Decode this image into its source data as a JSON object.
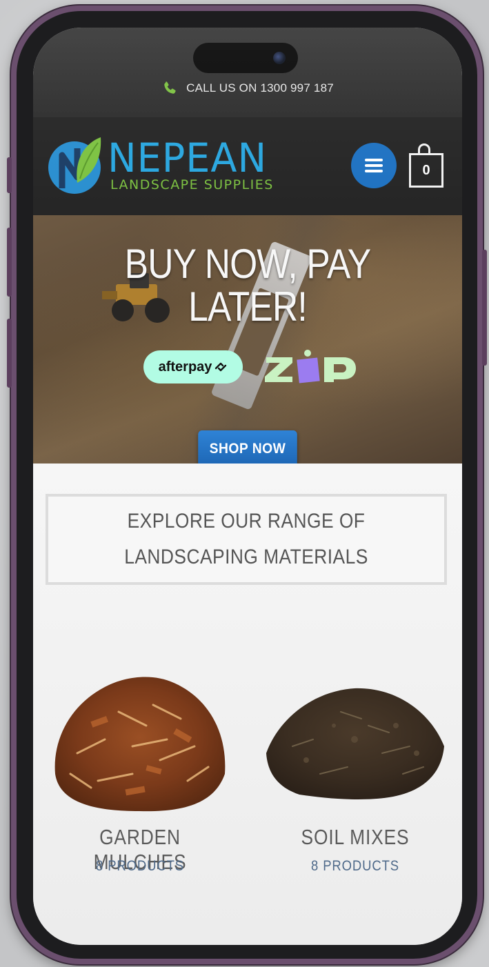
{
  "status_bar": {
    "call_text": "CALL US ON 1300 997 187",
    "phone_icon": "phone-icon"
  },
  "header": {
    "logo_title": "NEPEAN",
    "logo_subtitle": "LANDSCAPE SUPPLIES",
    "menu_icon": "hamburger-icon",
    "cart_count": "0",
    "colors": {
      "logo_blue": "#2aa7e0",
      "logo_green": "#7dc242",
      "menu_button": "#1f72c2",
      "header_bg": "#262626"
    }
  },
  "hero": {
    "title_line1": "BUY NOW, PAY",
    "title_line2": "LATER!",
    "afterpay_label": "afterpay",
    "zip_label": "ZIP",
    "shop_button": "SHOP NOW"
  },
  "explore": {
    "heading": "EXPLORE OUR RANGE OF LANDSCAPING MATERIALS"
  },
  "products": [
    {
      "name": "GARDEN MULCHES",
      "count": "8 PRODUCTS"
    },
    {
      "name": "SOIL MIXES",
      "count": "8 PRODUCTS"
    }
  ]
}
